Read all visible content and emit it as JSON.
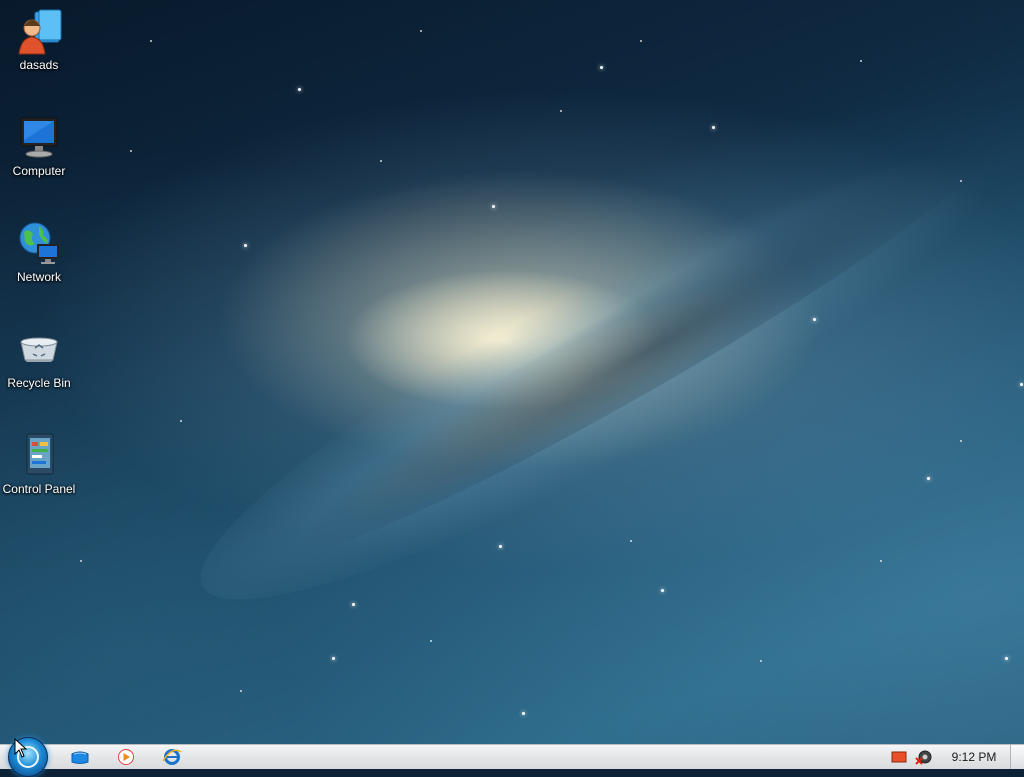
{
  "desktop": {
    "icons": [
      {
        "label": "dasads",
        "icon": "user-folder-icon"
      },
      {
        "label": "Computer",
        "icon": "computer-icon"
      },
      {
        "label": "Network",
        "icon": "network-icon"
      },
      {
        "label": "Recycle Bin",
        "icon": "recycle-bin-icon"
      },
      {
        "label": "Control Panel",
        "icon": "control-panel-icon"
      }
    ]
  },
  "taskbar": {
    "start_button": "start-orb-icon",
    "pinned": [
      {
        "icon": "windows-explorer-icon"
      },
      {
        "icon": "media-player-icon"
      },
      {
        "icon": "internet-explorer-icon"
      }
    ],
    "tray": [
      {
        "icon": "action-center-flag-icon"
      },
      {
        "icon": "network-disconnected-icon"
      }
    ],
    "clock": "9:12 PM"
  },
  "colors": {
    "taskbar_bg": "#e4e6e8",
    "start_orb": "#1c8ad6",
    "wallpaper_dark": "#0f2a42",
    "wallpaper_light": "#f5e6be"
  }
}
